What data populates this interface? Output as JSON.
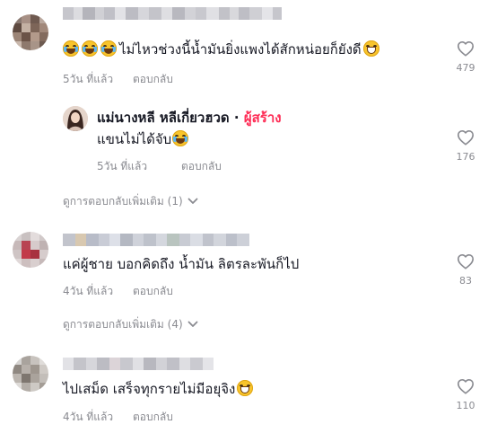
{
  "comments": [
    {
      "text": "ไม่ไหวช่วงนี้น้ำมันยิ่งแพงได้สักหน่อยก็ยังดี",
      "time": "5วัน ที่แล้ว",
      "reply": "ตอบกลับ",
      "likes": "479",
      "reply_item": {
        "author": "แม่นางหลี หลีเกี่ยวฮวด",
        "separator": "·",
        "badge": "ผู้สร้าง",
        "text": "แขนไม่ได้จับ",
        "time": "5วัน ที่แล้ว",
        "reply": "ตอบกลับ",
        "likes": "176"
      },
      "more_replies": "ดูการตอบกลับเพิ่มเติม (1)"
    },
    {
      "text": "แค่ผู้ชาย บอกคิดถึง น้ำมัน ลิตรละพันก็ไป",
      "time": "4วัน ที่แล้ว",
      "reply": "ตอบกลับ",
      "likes": "83",
      "more_replies": "ดูการตอบกลับเพิ่มเติม (4)"
    },
    {
      "text": "ไปเสม็ด เสร็จทุกรายไม่มีอยุจิง",
      "time": "4วัน ที่แล้ว",
      "reply": "ตอบกลับ",
      "likes": "110"
    }
  ],
  "icons": {
    "like": "heart-outline-icon",
    "expand": "chevron-down-icon",
    "emoji_laugh": "face-with-tears-of-joy-icon",
    "emoji_grin": "grinning-face-icon"
  },
  "colors": {
    "text": "#161823",
    "muted": "#8a8b91",
    "creator_badge": "#fe2c55"
  }
}
